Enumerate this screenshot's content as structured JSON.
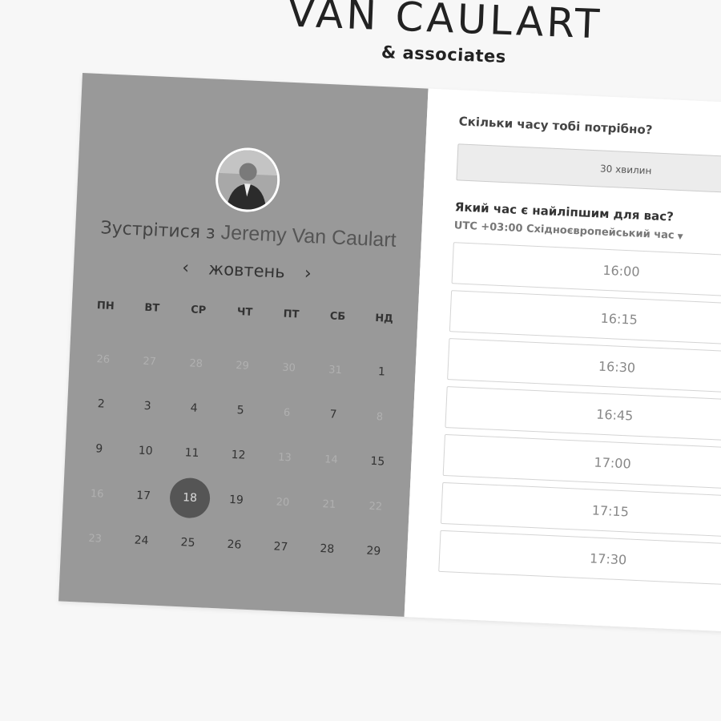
{
  "brand": {
    "name": "VAN CAULART",
    "sub": "& associates"
  },
  "scheduler": {
    "meet_prefix": "Зустрітися з",
    "host": "Jeremy Van Caulart",
    "month": "жовтень",
    "prev_icon": "chevron-left-icon",
    "next_icon": "chevron-right-icon",
    "weekdays": [
      "ПН",
      "ВТ",
      "СР",
      "ЧТ",
      "ПТ",
      "СБ",
      "НД"
    ],
    "days": [
      {
        "d": "26",
        "muted": true
      },
      {
        "d": "27",
        "muted": true
      },
      {
        "d": "28",
        "muted": true
      },
      {
        "d": "29",
        "muted": true
      },
      {
        "d": "30",
        "muted": true
      },
      {
        "d": "31",
        "muted": true
      },
      {
        "d": "1",
        "muted": false
      },
      {
        "d": "2",
        "muted": false
      },
      {
        "d": "3",
        "muted": false
      },
      {
        "d": "4",
        "muted": false
      },
      {
        "d": "5",
        "muted": false
      },
      {
        "d": "6",
        "muted": true
      },
      {
        "d": "7",
        "muted": false
      },
      {
        "d": "8",
        "muted": true
      },
      {
        "d": "9",
        "muted": false
      },
      {
        "d": "10",
        "muted": false
      },
      {
        "d": "11",
        "muted": false
      },
      {
        "d": "12",
        "muted": false
      },
      {
        "d": "13",
        "muted": true
      },
      {
        "d": "14",
        "muted": true
      },
      {
        "d": "15",
        "muted": false
      },
      {
        "d": "16",
        "muted": true
      },
      {
        "d": "17",
        "muted": false
      },
      {
        "d": "18",
        "muted": false,
        "selected": true
      },
      {
        "d": "19",
        "muted": false
      },
      {
        "d": "20",
        "muted": true
      },
      {
        "d": "21",
        "muted": true
      },
      {
        "d": "22",
        "muted": true
      },
      {
        "d": "23",
        "muted": true
      },
      {
        "d": "24",
        "muted": false
      },
      {
        "d": "25",
        "muted": false
      },
      {
        "d": "26",
        "muted": false
      },
      {
        "d": "27",
        "muted": false
      },
      {
        "d": "28",
        "muted": false
      },
      {
        "d": "29",
        "muted": false
      }
    ],
    "duration_question": "Скільки часу тобі потрібно?",
    "duration_value": "30 хвилин",
    "time_question": "Який час є найліпшим для вас?",
    "timezone": "UTC +03:00 Східноєвропейський час",
    "times": [
      "16:00",
      "16:15",
      "16:30",
      "16:45",
      "17:00",
      "17:15",
      "17:30"
    ]
  },
  "colors": {
    "left_panel": "#999999",
    "selected_day": "#555555",
    "page_bg": "#f7f7f7"
  }
}
